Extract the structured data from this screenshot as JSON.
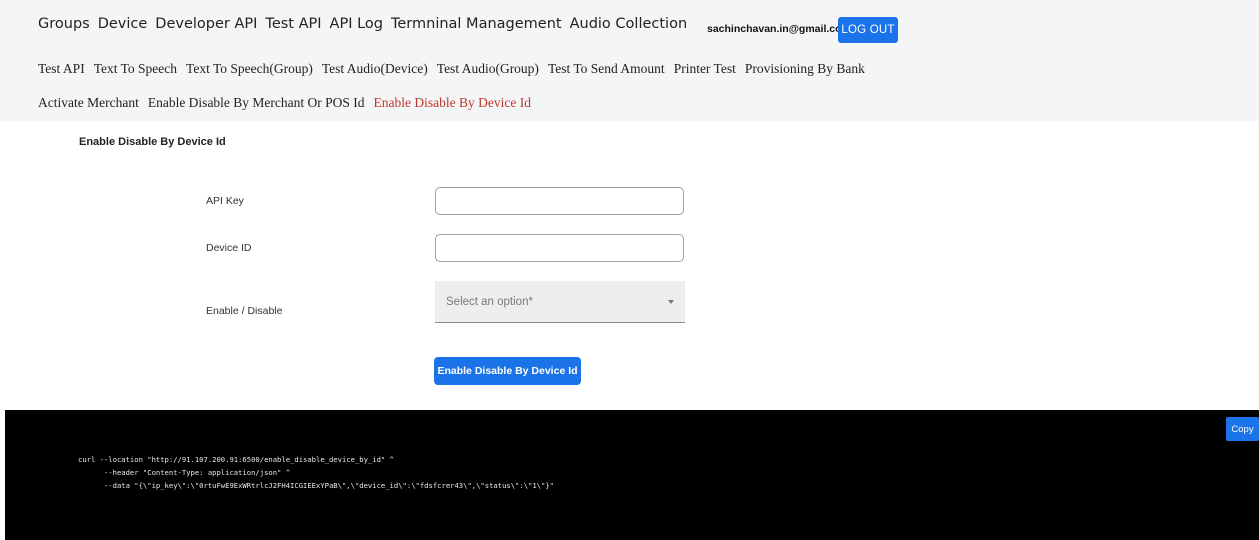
{
  "nav": {
    "main": [
      "Groups",
      "Device",
      "Developer API",
      "Test API",
      "API Log",
      "Termninal Management",
      "Audio Collection"
    ],
    "user_email": "sachinchavan.in@gmail.com",
    "logout_label": "LOG OUT",
    "sub_row_1": [
      "Test API",
      "Text To Speech",
      "Text To Speech(Group)",
      "Test Audio(Device)",
      "Test Audio(Group)",
      "Test To Send Amount",
      "Printer Test",
      "Provisioning By Bank"
    ],
    "sub_row_2": [
      "Activate Merchant",
      "Enable Disable By Merchant Or POS Id",
      "Enable Disable By Device Id"
    ],
    "active_color": "#c0392b"
  },
  "form": {
    "title": "Enable Disable By Device Id",
    "api_key_label": "API Key",
    "api_key_value": "",
    "device_id_label": "Device ID",
    "device_id_value": "",
    "enable_disable_label": "Enable / Disable",
    "select_placeholder": "Select an option*",
    "submit_label": "Enable Disable By Device Id"
  },
  "code": {
    "line1": "curl --location \"http://91.107.200.91:6500/enable_disable_device_by_id\" ^",
    "line2": "      --header \"Content-Type: application/json\" ^",
    "line3": "      --data \"{\\\"ip_key\\\":\\\"0rtuFwE9ExWRtrlcJ2FH4ICGIEExYPaB\\\",\\\"device_id\\\":\\\"fdsfcrer43\\\",\\\"status\\\":\\\"1\\\"}\"",
    "copy_label": "Copy"
  },
  "colors": {
    "primary": "#1a73e8",
    "topbar_bg": "#f4f5f7",
    "code_bg": "#000000"
  }
}
